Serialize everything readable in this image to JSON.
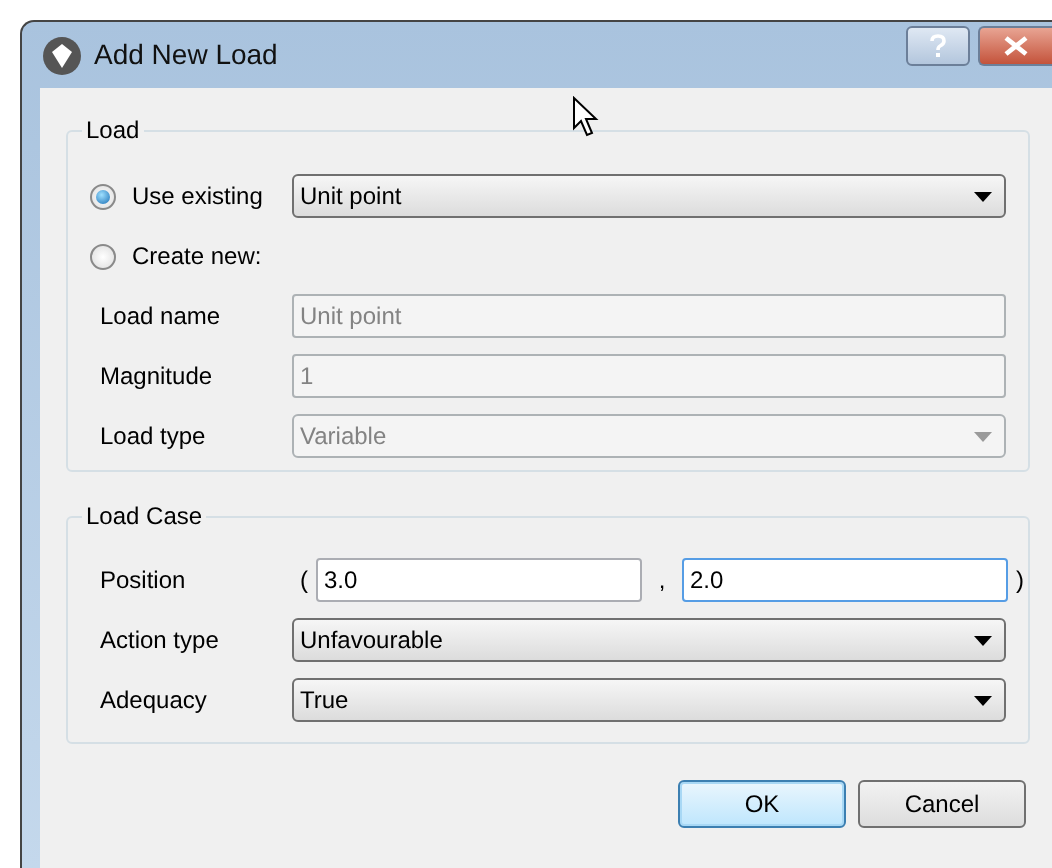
{
  "window": {
    "title": "Add New Load"
  },
  "load": {
    "title": "Load",
    "options": [
      {
        "label": "Use existing",
        "selected": true,
        "value": "Unit point"
      },
      {
        "label": "Create new:",
        "selected": false
      }
    ],
    "fields": [
      {
        "kind": "text",
        "label": "Load name",
        "value": "Unit point",
        "disabled": true
      },
      {
        "kind": "text",
        "label": "Magnitude",
        "value": "1",
        "disabled": true
      },
      {
        "kind": "select",
        "label": "Load type",
        "value": "Variable",
        "disabled": true
      }
    ]
  },
  "load_case": {
    "title": "Load Case",
    "position": {
      "label": "Position",
      "open": "(",
      "separator": ",",
      "close": ")",
      "inputs": [
        {
          "value": "3.0",
          "focused": false
        },
        {
          "value": "2.0",
          "focused": true
        }
      ]
    },
    "fields": [
      {
        "kind": "select",
        "label": "Action type",
        "value": "Unfavourable",
        "disabled": false
      },
      {
        "kind": "select",
        "label": "Adequacy",
        "value": "True",
        "disabled": false
      }
    ]
  },
  "buttons": [
    {
      "label": "OK",
      "default": true
    },
    {
      "label": "Cancel",
      "default": false
    }
  ]
}
